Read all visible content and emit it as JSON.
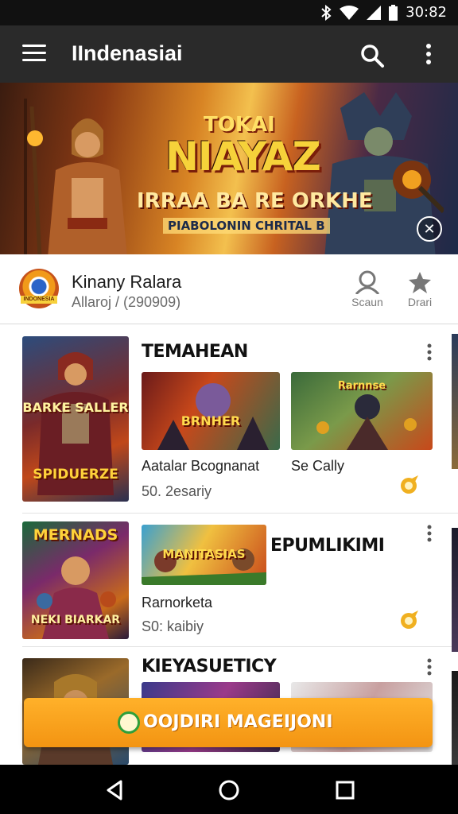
{
  "status_bar": {
    "time": "30:82",
    "bluetooth_icon": "bluetooth-icon",
    "wifi_icon": "wifi-icon",
    "signal_icon": "signal-icon",
    "battery_icon": "battery-icon"
  },
  "app_bar": {
    "title": "IIndenasiai",
    "menu_icon": "hamburger-menu-icon",
    "search_icon": "search-icon",
    "more_icon": "more-vertical-icon"
  },
  "banner": {
    "logo_top": "TOKAI",
    "logo": "NIAYAZ",
    "subtitle": "IRRAA BA RE ORKHE",
    "tagline": "PIABOLONIN CHRITAL B",
    "close_icon": "close-icon"
  },
  "publisher": {
    "name": "Kinany Ralara",
    "subtitle": "Allaroj / (290909)",
    "avatar_tag": "INDONESIA",
    "actions": [
      {
        "label": "Scaun",
        "icon": "user-icon"
      },
      {
        "label": "Drari",
        "icon": "star-badge-icon"
      }
    ]
  },
  "sections": [
    {
      "title": "TEMAHEAN",
      "poster_label": "SPIDUERZE",
      "poster_top_label": "BARKE SALLER",
      "items": [
        {
          "name": "Aatalar Bcognanat",
          "meta": "50. 2esariy",
          "thumb_label": "BRNHER"
        },
        {
          "name": "Se Cally",
          "meta": "",
          "thumb_label": "Rarnnse"
        }
      ]
    },
    {
      "title": "EPUMLIKIMI",
      "poster_label": "MERNADS",
      "poster_bottom_label": "NEKI BIARKAR",
      "items": [
        {
          "name": "Rarnorketa",
          "meta": "S0: kaibiy",
          "thumb_label": "MANITASIAS"
        }
      ]
    },
    {
      "title": "KIEYASUETICY",
      "items": []
    }
  ],
  "install_button": {
    "label": "OOJDIRI MAGEIJONI",
    "icon": "play-icon"
  },
  "nav_bar": {
    "back_icon": "back-icon",
    "home_icon": "home-icon",
    "recents_icon": "recents-icon"
  },
  "colors": {
    "app_bar": "#2a2a2a",
    "accent": "#f39412",
    "status_bar": "#111111"
  }
}
